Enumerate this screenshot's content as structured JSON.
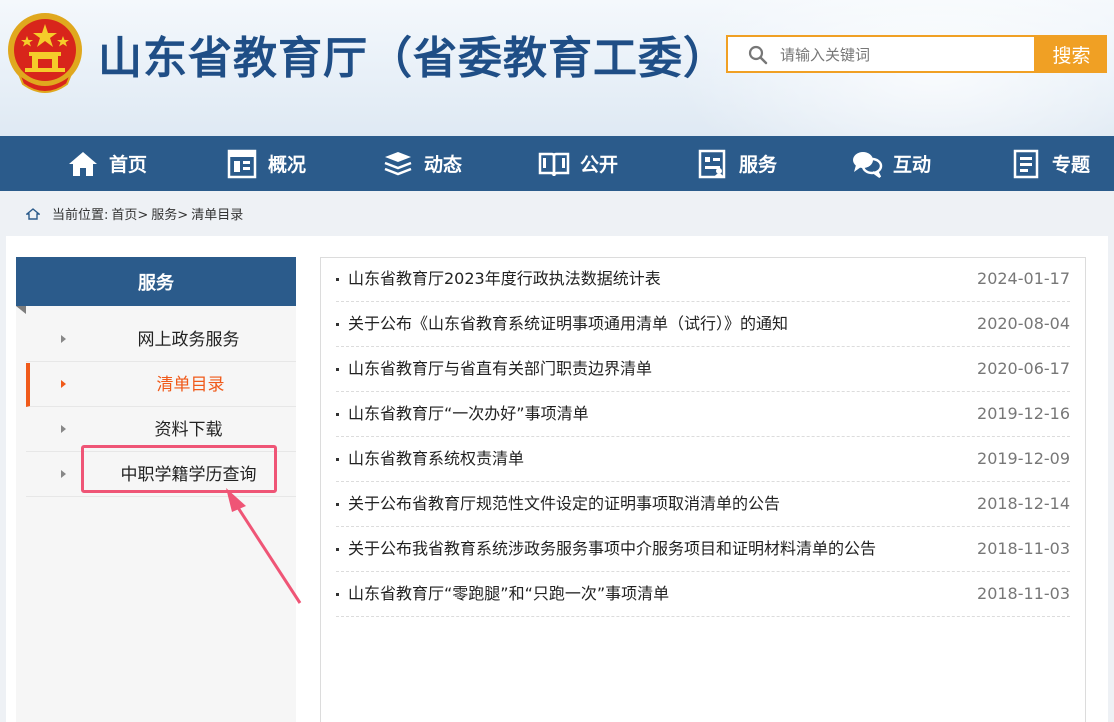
{
  "header": {
    "site_title": "山东省教育厅（省委教育工委）",
    "search_placeholder": "请输入关键词",
    "search_button": "搜索"
  },
  "nav": {
    "items": [
      {
        "label": "首页",
        "icon": "home-icon"
      },
      {
        "label": "概况",
        "icon": "overview-icon"
      },
      {
        "label": "动态",
        "icon": "news-icon"
      },
      {
        "label": "公开",
        "icon": "open-book-icon"
      },
      {
        "label": "服务",
        "icon": "service-icon"
      },
      {
        "label": "互动",
        "icon": "chat-icon"
      },
      {
        "label": "专题",
        "icon": "topic-icon"
      }
    ]
  },
  "breadcrumb": {
    "prefix": "当前位置:",
    "items": [
      "首页>",
      "服务>",
      "清单目录"
    ]
  },
  "sidebar": {
    "title": "服务",
    "items": [
      {
        "label": "网上政务服务",
        "active": false
      },
      {
        "label": "清单目录",
        "active": true
      },
      {
        "label": "资料下载",
        "active": false
      },
      {
        "label": "中职学籍学历查询",
        "active": false
      }
    ]
  },
  "list": {
    "items": [
      {
        "title": "山东省教育厅2023年度行政执法数据统计表",
        "date": "2024-01-17"
      },
      {
        "title": "关于公布《山东省教育系统证明事项通用清单（试行）》的通知",
        "date": "2020-08-04"
      },
      {
        "title": "山东省教育厅与省直有关部门职责边界清单",
        "date": "2020-06-17"
      },
      {
        "title": "山东省教育厅“一次办好”事项清单",
        "date": "2019-12-16"
      },
      {
        "title": "山东省教育系统权责清单",
        "date": "2019-12-09"
      },
      {
        "title": "关于公布省教育厅规范性文件设定的证明事项取消清单的公告",
        "date": "2018-12-14"
      },
      {
        "title": "关于公布我省教育系统涉政务服务事项中介服务项目和证明材料清单的公告",
        "date": "2018-11-03"
      },
      {
        "title": "山东省教育厅“零跑腿”和“只跑一次”事项清单",
        "date": "2018-11-03"
      }
    ]
  },
  "colors": {
    "primary": "#2b5b8b",
    "accent": "#f0a024",
    "active": "#f05a1a",
    "annotation": "#ef5576"
  }
}
